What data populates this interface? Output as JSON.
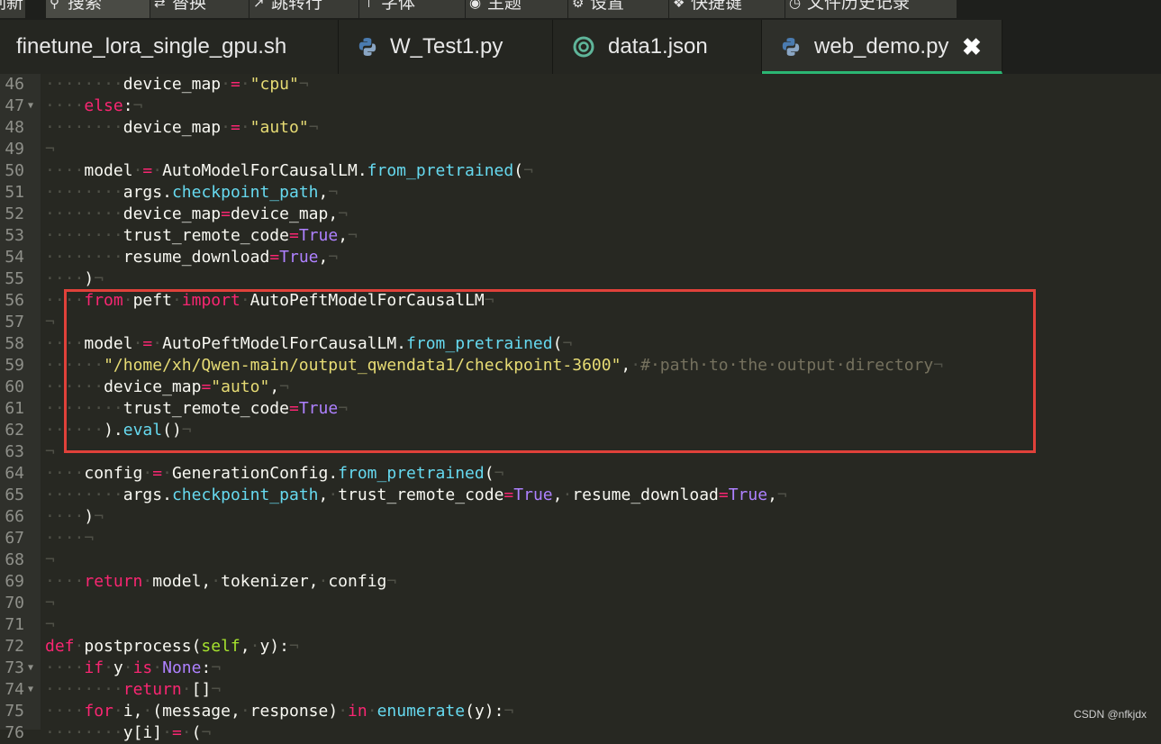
{
  "menu": {
    "items": [
      {
        "label": "刷新",
        "icon": ""
      },
      {
        "label": "搜索",
        "icon": "search-icon"
      },
      {
        "label": "替换",
        "icon": "replace-icon"
      },
      {
        "label": "跳转行",
        "icon": "goto-line-icon"
      },
      {
        "label": "字体",
        "icon": "font-icon"
      },
      {
        "label": "主题",
        "icon": "theme-icon"
      },
      {
        "label": "设置",
        "icon": "gear-icon"
      },
      {
        "label": "快捷键",
        "icon": "info-icon"
      },
      {
        "label": "文件历史记录",
        "icon": "history-icon"
      }
    ],
    "active_index": 1
  },
  "tabs": [
    {
      "label": "finetune_lora_single_gpu.sh",
      "icon": ""
    },
    {
      "label": "W_Test1.py",
      "icon": "python-icon"
    },
    {
      "label": "data1.json",
      "icon": "json-icon"
    },
    {
      "label": "web_demo.py",
      "icon": "python-icon",
      "active": true,
      "close": "✖"
    }
  ],
  "editor": {
    "line_numbers": [
      "46",
      "47",
      "48",
      "49",
      "50",
      "51",
      "52",
      "53",
      "54",
      "55",
      "56",
      "57",
      "58",
      "59",
      "60",
      "61",
      "62",
      "63",
      "64",
      "65",
      "66",
      "67",
      "68",
      "69",
      "70",
      "71",
      "72",
      "73",
      "74",
      "75",
      "76"
    ],
    "folded_lines": [
      "47",
      "73",
      "74"
    ],
    "lines": [
      "········device_map = \"cpu\"¬",
      "····else:¬",
      "········device_map = \"auto\"¬",
      "¬",
      "····model = AutoModelForCausalLM.from_pretrained(¬",
      "········args.checkpoint_path,¬",
      "········device_map=device_map,¬",
      "········trust_remote_code=True,¬",
      "········resume_download=True,¬",
      "····)¬",
      "····from peft import AutoPeftModelForCausalLM¬",
      "¬",
      "····model = AutoPeftModelForCausalLM.from_pretrained(¬",
      "······\"/home/xh/Qwen-main/output_qwendata1/checkpoint-3600\", # path to the output directory¬",
      "······device_map=\"auto\",¬",
      "········trust_remote_code=True¬",
      "······).eval()¬",
      "¬",
      "····config = GenerationConfig.from_pretrained(¬",
      "········args.checkpoint_path, trust_remote_code=True, resume_download=True,¬",
      "····)¬",
      "····¬",
      "¬",
      "····return model, tokenizer, config¬",
      "¬",
      "¬",
      "def postprocess(self, y):¬",
      "····if y is None:¬",
      "········return []¬",
      "····for i, (message, response) in enumerate(y):¬",
      "········y[i] = (¬"
    ]
  },
  "watermark": "CSDN @nfkjdx",
  "colors": {
    "background": "#272822",
    "active_tab_underline": "#2bb673",
    "highlight_box": "#e0413a",
    "keyword": "#f92672",
    "string": "#e6db74",
    "function": "#66d9ef",
    "constant": "#ae81ff",
    "comment": "#75715e"
  }
}
